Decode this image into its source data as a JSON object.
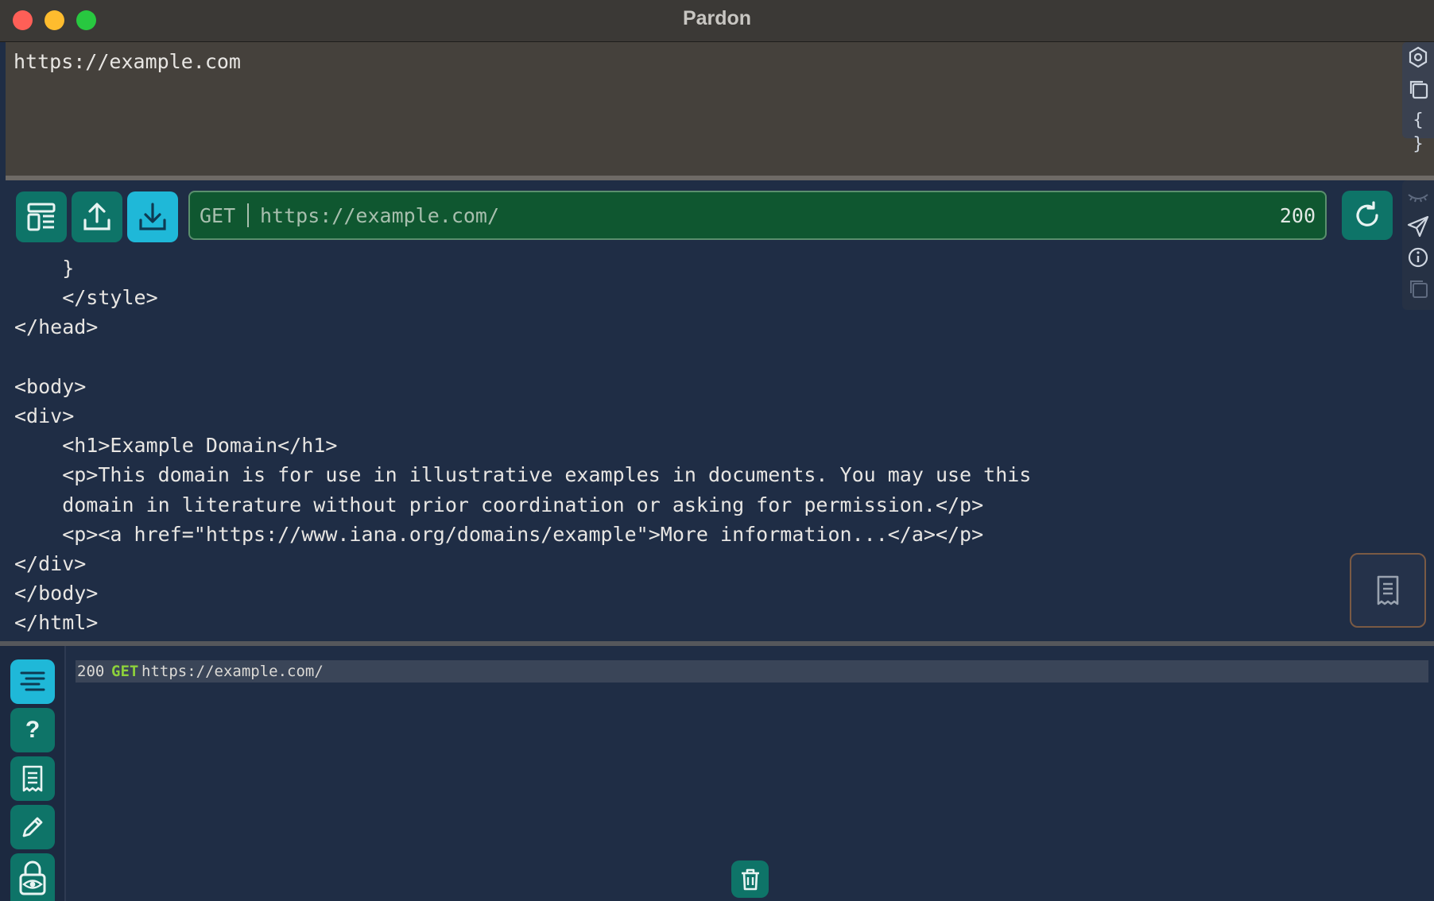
{
  "window": {
    "title": "Pardon"
  },
  "request": {
    "text": "https://example.com"
  },
  "right_tools_top": {
    "icons": [
      "settings-hexagon-icon",
      "copy-icon",
      "braces-icon"
    ],
    "braces_label": "{ }"
  },
  "toolbar": {
    "buttons": [
      "layout-icon",
      "upload-icon",
      "download-icon"
    ],
    "method": "GET",
    "url": "https://example.com/",
    "status": "200"
  },
  "right_tools_mid": {
    "icons": [
      "eye-closed-icon",
      "send-icon",
      "info-icon",
      "copy-icon"
    ]
  },
  "response": {
    "lines": [
      "    }",
      "    </style>",
      "</head>",
      "",
      "<body>",
      "<div>",
      "    <h1>Example Domain</h1>",
      "    <p>This domain is for use in illustrative examples in documents. You may use this",
      "    domain in literature without prior coordination or asking for permission.</p>",
      "    <p><a href=\"https://www.iana.org/domains/example\">More information...</a></p>",
      "</div>",
      "</body>",
      "</html>"
    ]
  },
  "history": {
    "items": [
      {
        "status": "200",
        "method": "GET",
        "url": "https://example.com/"
      }
    ]
  },
  "left_rail": {
    "icons": [
      "list-icon",
      "help-icon",
      "receipt-icon",
      "pencil-icon",
      "lock-eye-icon"
    ],
    "help_label": "?"
  },
  "colors": {
    "accent_light": "#1fb8d8",
    "accent_dark": "#0e7468",
    "url_ok": "#0f5730"
  }
}
